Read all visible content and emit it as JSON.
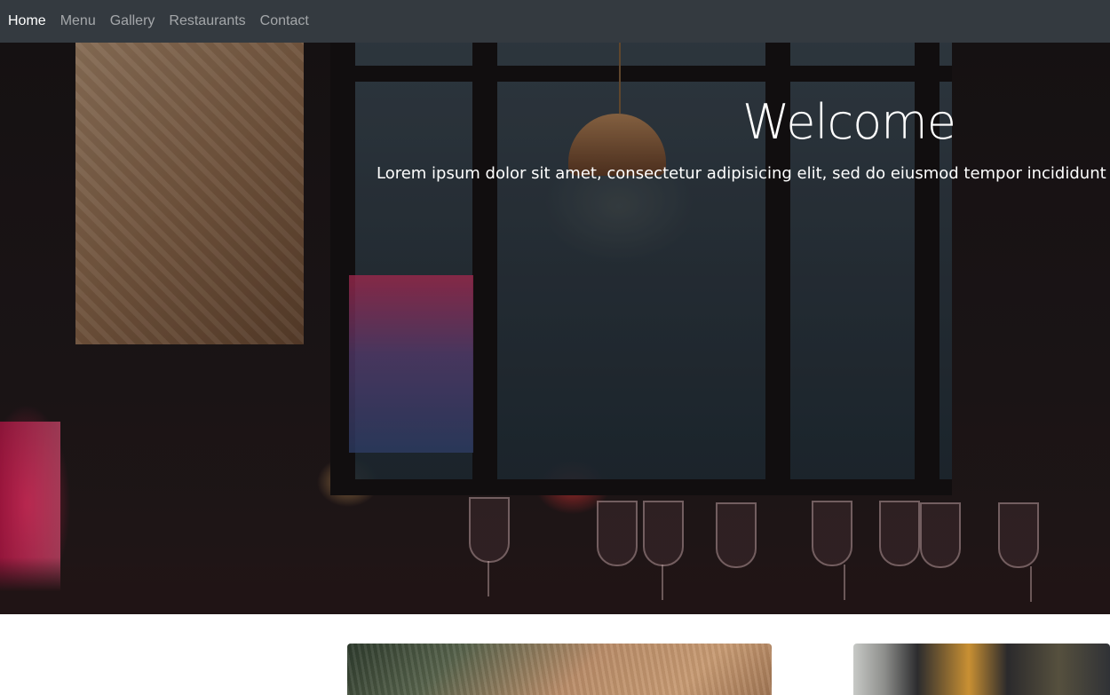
{
  "navbar": {
    "items": [
      {
        "label": "Home",
        "active": true
      },
      {
        "label": "Menu",
        "active": false
      },
      {
        "label": "Gallery",
        "active": false
      },
      {
        "label": "Restaurants",
        "active": false
      },
      {
        "label": "Contact",
        "active": false
      }
    ],
    "background": "#343a40"
  },
  "hero": {
    "title": "Welcome",
    "text": "Lorem ipsum dolor sit amet, consectetur adipisicing elit, sed do eiusmod tempor incididunt ut labore"
  }
}
